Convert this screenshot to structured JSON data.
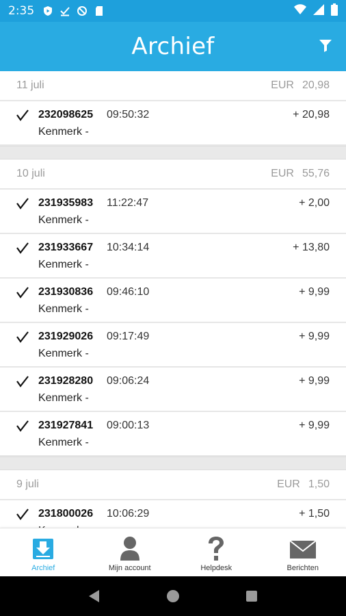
{
  "status_bar": {
    "time": "2:35",
    "icons": [
      "play-protect-icon",
      "download-done-icon",
      "no-sync-icon",
      "sd-card-icon"
    ],
    "right_icons": [
      "wifi-icon",
      "signal-icon",
      "battery-icon"
    ]
  },
  "app_bar": {
    "title": "Archief",
    "filter_icon": "filter-icon",
    "color": "#29abe2"
  },
  "days": [
    {
      "date": "11 juli",
      "currency": "EUR",
      "total": "20,98",
      "transactions": [
        {
          "number": "232098625",
          "time": "09:50:32",
          "amount": "+ 20,98",
          "reference": "Kenmerk -"
        }
      ]
    },
    {
      "date": "10 juli",
      "currency": "EUR",
      "total": "55,76",
      "transactions": [
        {
          "number": "231935983",
          "time": "11:22:47",
          "amount": "+ 2,00",
          "reference": "Kenmerk -"
        },
        {
          "number": "231933667",
          "time": "10:34:14",
          "amount": "+ 13,80",
          "reference": "Kenmerk -"
        },
        {
          "number": "231930836",
          "time": "09:46:10",
          "amount": "+ 9,99",
          "reference": "Kenmerk -"
        },
        {
          "number": "231929026",
          "time": "09:17:49",
          "amount": "+ 9,99",
          "reference": "Kenmerk -"
        },
        {
          "number": "231928280",
          "time": "09:06:24",
          "amount": "+ 9,99",
          "reference": "Kenmerk -"
        },
        {
          "number": "231927841",
          "time": "09:00:13",
          "amount": "+ 9,99",
          "reference": "Kenmerk -"
        }
      ]
    },
    {
      "date": "9 juli",
      "currency": "EUR",
      "total": "1,50",
      "transactions": [
        {
          "number": "231800026",
          "time": "10:06:29",
          "amount": "+ 1,50",
          "reference": "Kenmerk -"
        }
      ]
    }
  ],
  "bottom_nav": {
    "items": [
      {
        "label": "Archief",
        "icon": "archive-download-icon",
        "active": true
      },
      {
        "label": "Mijn account",
        "icon": "person-icon",
        "active": false
      },
      {
        "label": "Helpdesk",
        "icon": "question-icon",
        "active": false
      },
      {
        "label": "Berichten",
        "icon": "envelope-icon",
        "active": false
      }
    ]
  },
  "system_nav": [
    "back-icon",
    "home-icon",
    "recents-icon"
  ]
}
